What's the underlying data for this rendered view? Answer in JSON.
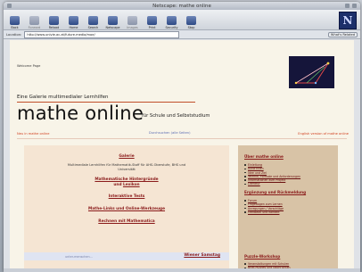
{
  "window": {
    "title": "Netscape: mathe online"
  },
  "toolbar": {
    "buttons": [
      "Back",
      "Forward",
      "Reload",
      "Home",
      "Search",
      "Netscape",
      "Images",
      "Print",
      "Security",
      "Stop"
    ]
  },
  "location": {
    "label": "Location:",
    "url": "http://www.univie.ac.at/future.media/moe/",
    "related": "What's Related"
  },
  "page": {
    "welcome": "Welcome Page",
    "subtitle": "Eine Galerie multimedialer Lernhilfen",
    "title": "mathe online",
    "tagline": "für Schule und Selbststudium",
    "link_left": "Neu in mathe online",
    "link_center": "Durchsuchen (alle Seiten)",
    "link_right": "English version of mathe online"
  },
  "left_column": {
    "galerie": "Galerie",
    "galerie_desc_1": "Multimediale Lernhilfen für Mathematik-Stoff für AHS-Oberstufe, BHS und",
    "galerie_desc_2": "Universität",
    "hintergrund": "Mathematische Hintergründe",
    "und": "und",
    "lexikon": "Lexikon",
    "tests": "Interaktive Tests",
    "links": "Mathe-Links und Online-Werkzeuge",
    "rechnen": "Rechnen mit Mathematica",
    "lernen": "unter-menschen...",
    "samstag": "Wiener Samstag"
  },
  "right_column": {
    "ueber": "Über mathe online",
    "ueber_items": [
      "Einleitung",
      "Autorinnen",
      "Idee und Ziel",
      "Technik, Formate und Anforderungen",
      "Informationen zum Projekt",
      "Literatur"
    ],
    "ergaenzung": "Ergänzung und Rückmeldung",
    "ergaenzung_items": [
      "Forum",
      "Fragebogen zum Lernen",
      "Anregungen / Vorschläge",
      "Feedback und Kontakt"
    ],
    "puzzle": "Puzzle-Workshop",
    "puzzle_items": [
      "Veranstaltungen mit Schulen",
      "Brief-Puzzles und Nachrichten"
    ]
  },
  "colors": {
    "accent_red": "#d1401f",
    "link_dark_red": "#8a1a1a",
    "page_bg": "#f8f4e8",
    "left_box": "#f5e5d3",
    "right_box": "#d8c3a6"
  }
}
